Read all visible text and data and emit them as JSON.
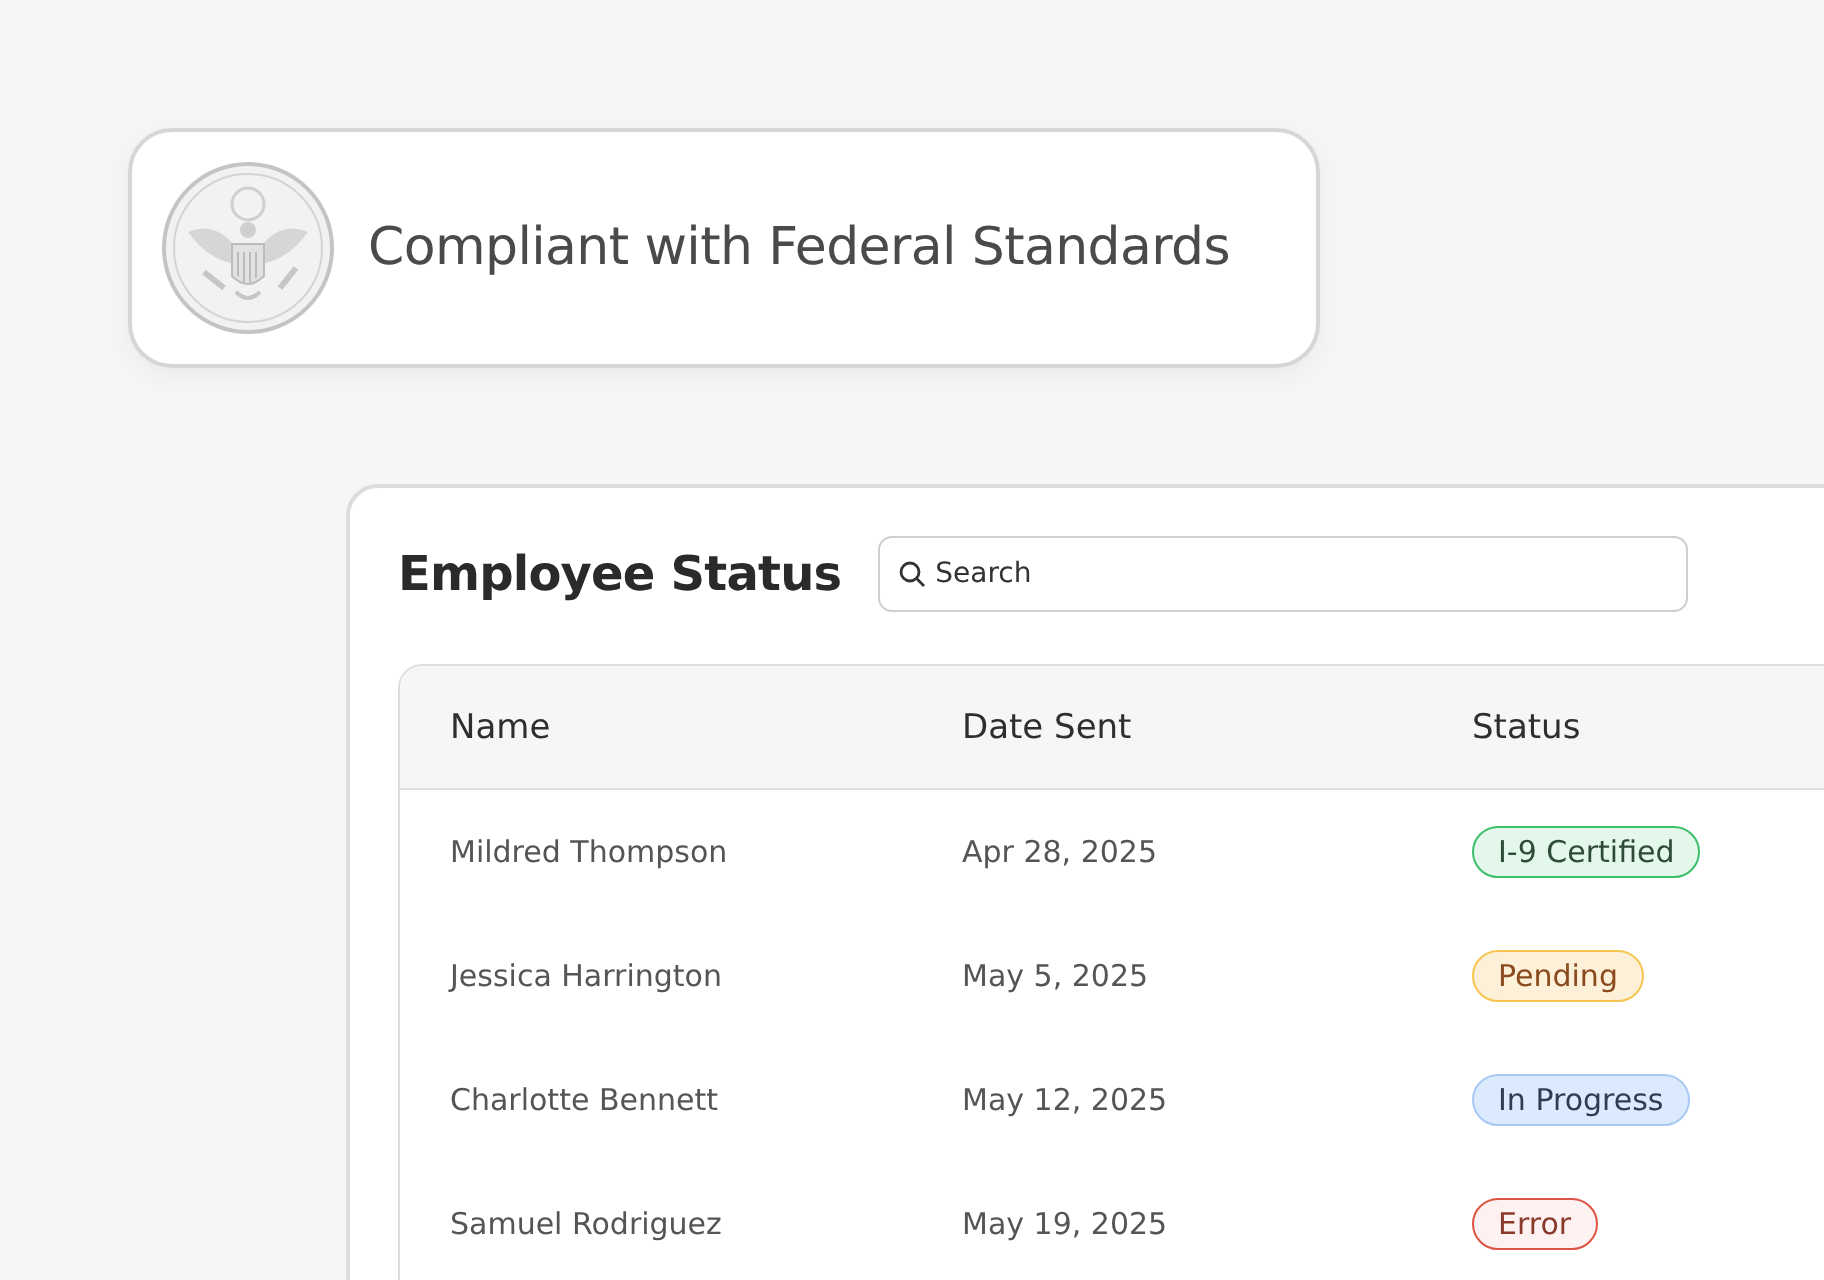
{
  "compliance_banner": {
    "text": "Compliant with Federal Standards"
  },
  "employee_panel": {
    "title": "Employee Status",
    "search": {
      "placeholder": "Search"
    },
    "table": {
      "columns": [
        "Name",
        "Date Sent",
        "Status"
      ],
      "rows": [
        {
          "name": "Mildred Thompson",
          "date_sent": "Apr 28, 2025",
          "status": {
            "label": "I-9 Certified",
            "kind": "certified"
          }
        },
        {
          "name": "Jessica Harrington",
          "date_sent": "May 5, 2025",
          "status": {
            "label": "Pending",
            "kind": "pending"
          }
        },
        {
          "name": "Charlotte Bennett",
          "date_sent": "May 12, 2025",
          "status": {
            "label": "In Progress",
            "kind": "progress"
          }
        },
        {
          "name": "Samuel Rodriguez",
          "date_sent": "May 19, 2025",
          "status": {
            "label": "Error",
            "kind": "error"
          }
        }
      ]
    }
  }
}
